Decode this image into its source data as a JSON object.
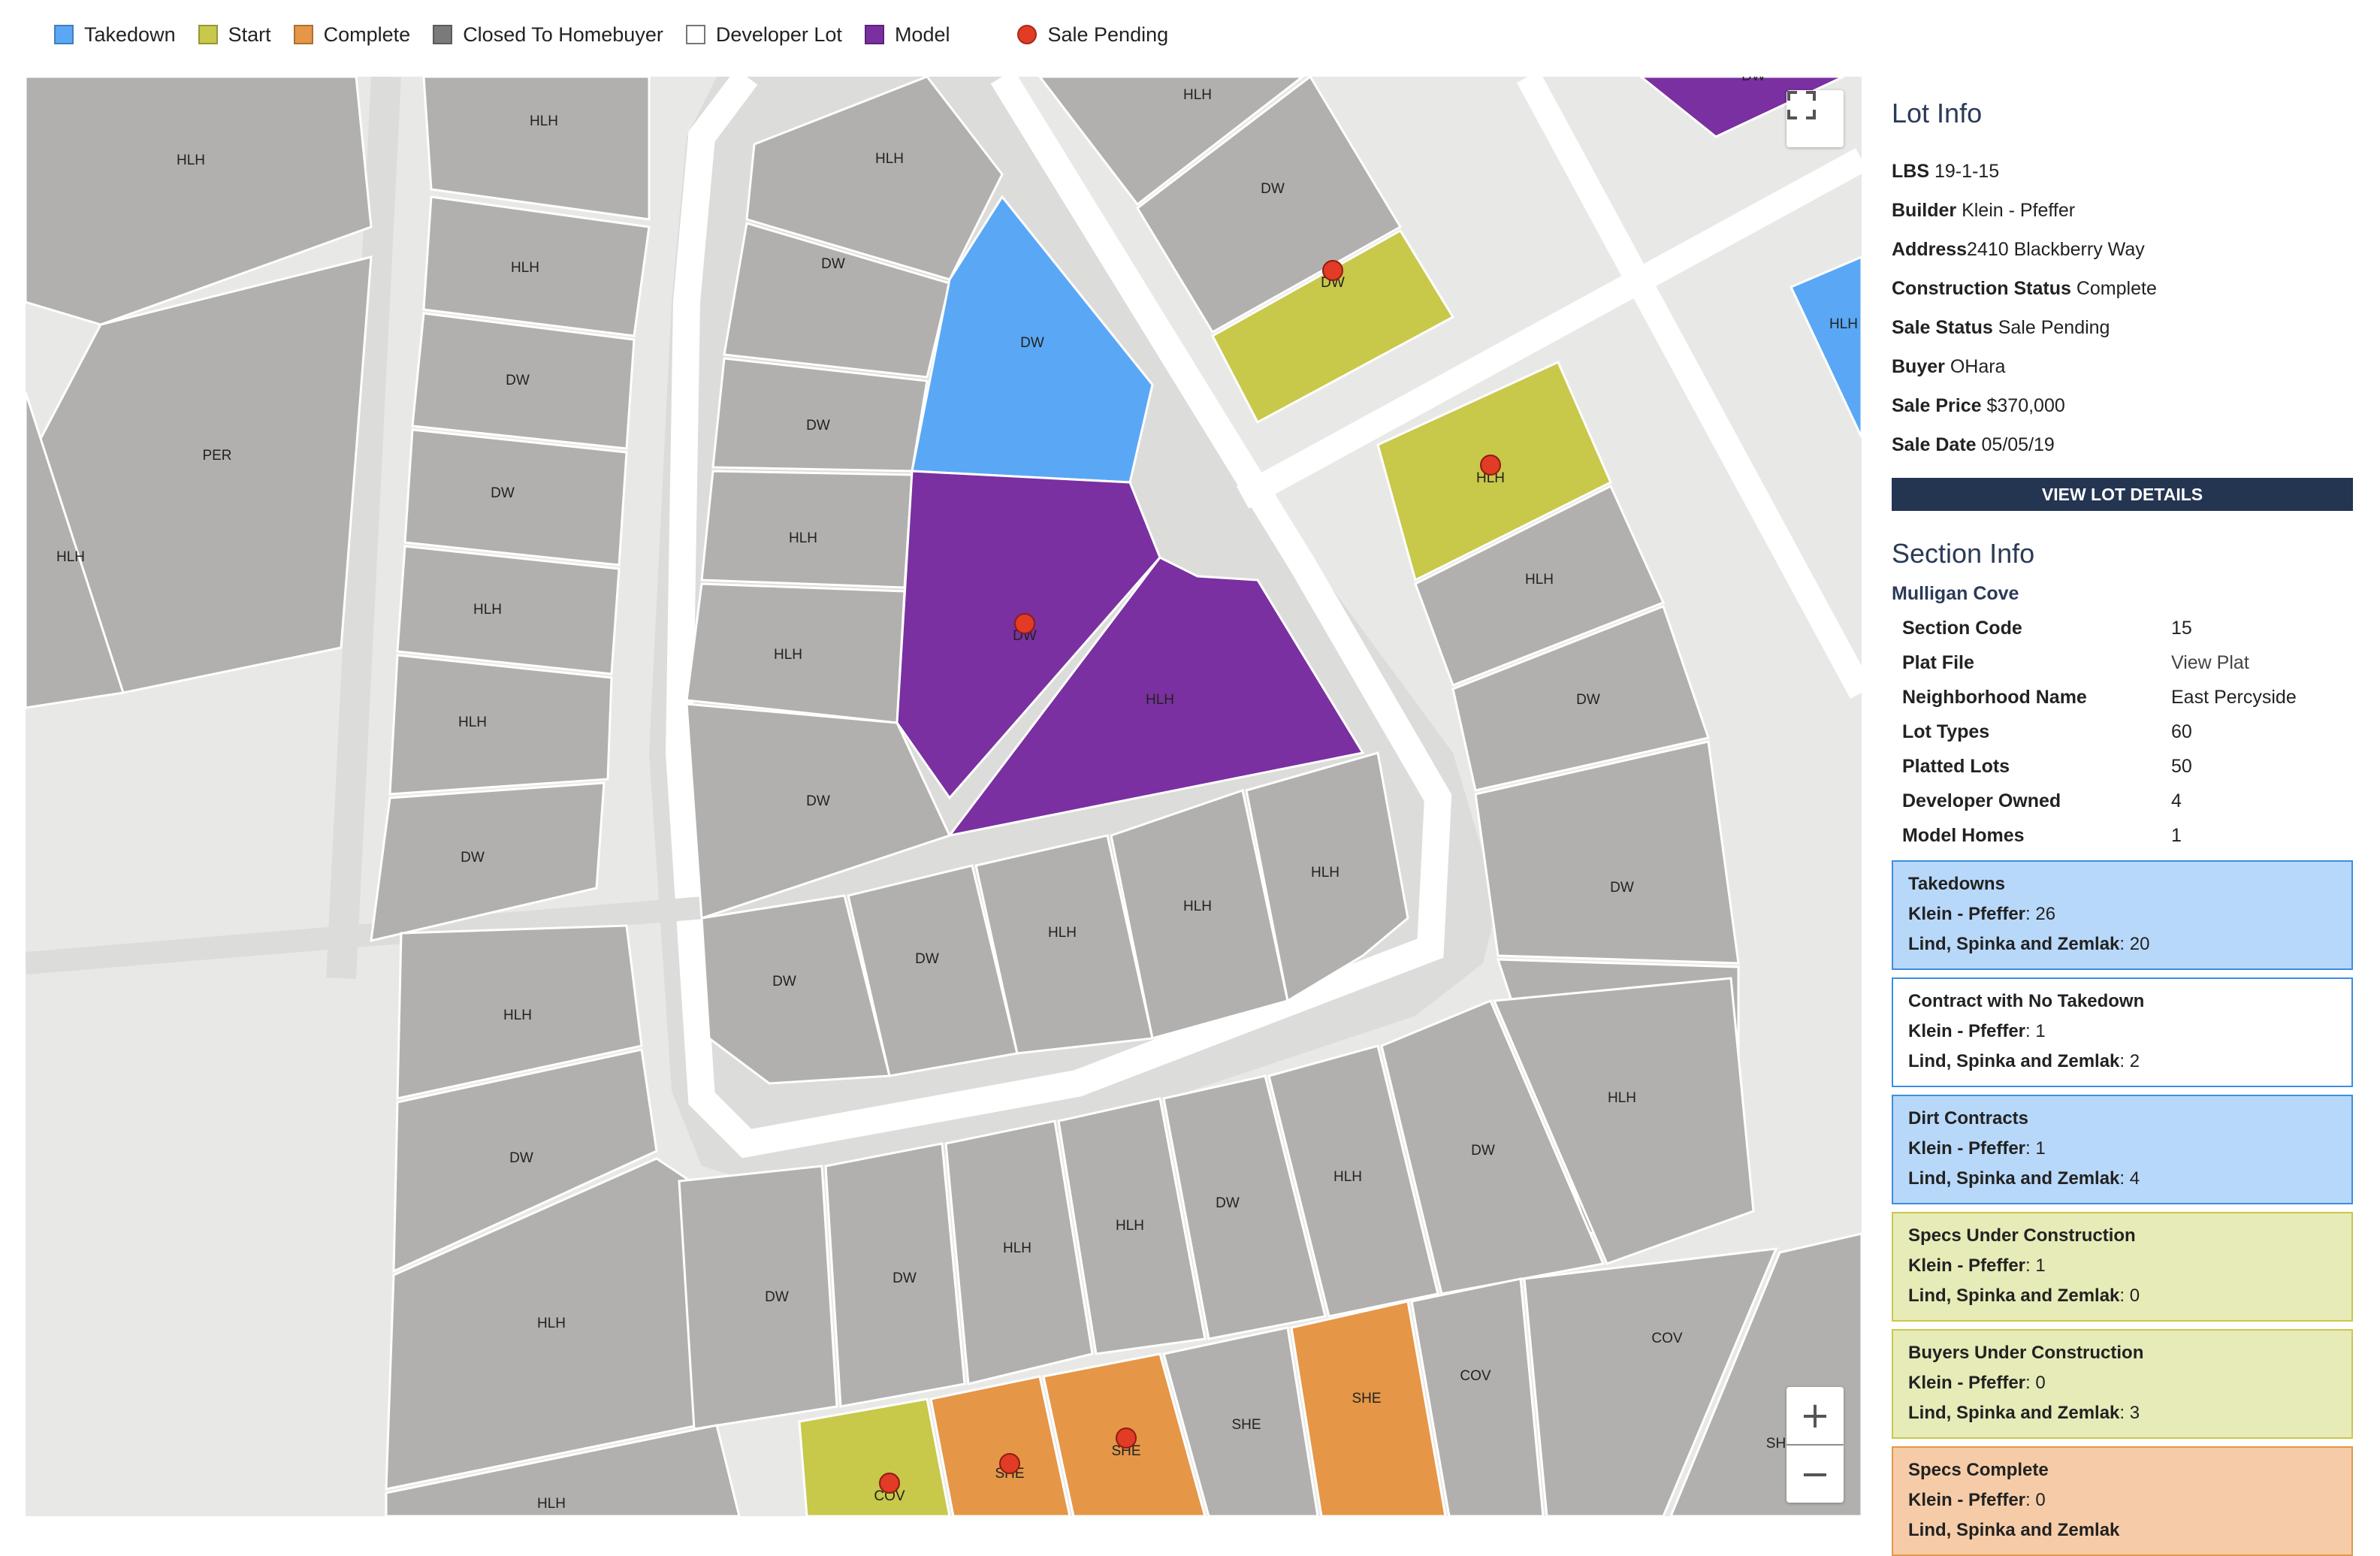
{
  "legend": [
    {
      "label": "Takedown",
      "color": "#5aa8f5",
      "kind": "square",
      "name": "takedown"
    },
    {
      "label": "Start",
      "color": "#c8c84a",
      "kind": "square",
      "name": "start"
    },
    {
      "label": "Complete",
      "color": "#e59647",
      "kind": "square",
      "name": "complete"
    },
    {
      "label": "Closed To Homebuyer",
      "color": "#7a7a7a",
      "kind": "square",
      "name": "closed"
    },
    {
      "label": "Developer Lot",
      "color": "#ffffff",
      "kind": "square",
      "name": "developer"
    },
    {
      "label": "Model",
      "color": "#7a30a0",
      "kind": "square",
      "name": "model"
    },
    {
      "label": "Sale Pending",
      "color": "#e23b26",
      "kind": "dot",
      "name": "sale-pending"
    }
  ],
  "map": {
    "controls": {
      "fullscreen_icon": "fullscreen-icon",
      "zoom_in": "+",
      "zoom_out": "−"
    },
    "lot_colors": {
      "default": "#b1b0ae",
      "takedown": "#5aa8f5",
      "start": "#c8c84a",
      "complete": "#e59647",
      "model": "#7a30a0"
    },
    "lot_labels": [
      "HLH",
      "DW",
      "PER",
      "SHE",
      "COV",
      "SH"
    ]
  },
  "lot_info": {
    "heading": "Lot Info",
    "rows": [
      {
        "label": "LBS",
        "value": " 19-1-15"
      },
      {
        "label": "Builder",
        "value": " Klein - Pfeffer"
      },
      {
        "label": "Address",
        "value": "2410 Blackberry Way"
      },
      {
        "label": "Construction Status",
        "value": " Complete"
      },
      {
        "label": "Sale Status",
        "value": " Sale Pending"
      },
      {
        "label": "Buyer",
        "value": " OHara"
      },
      {
        "label": "Sale Price",
        "value": " $370,000"
      },
      {
        "label": "Sale Date",
        "value": " 05/05/19"
      }
    ],
    "button": "VIEW LOT DETAILS"
  },
  "section_info": {
    "heading": "Section Info",
    "name": "Mulligan Cove",
    "stats": [
      {
        "label": "Section Code",
        "value": "15",
        "link": false
      },
      {
        "label": "Plat File",
        "value": "View Plat",
        "link": true
      },
      {
        "label": "Neighborhood Name",
        "value": "East Percyside",
        "link": false
      },
      {
        "label": "Lot Types",
        "value": "60",
        "link": false
      },
      {
        "label": "Platted Lots",
        "value": "50",
        "link": false
      },
      {
        "label": "Developer Owned",
        "value": "4",
        "link": false
      },
      {
        "label": "Model Homes",
        "value": "1",
        "link": false
      }
    ],
    "cards": [
      {
        "title": "Takedowns",
        "bg": "#b8d8fa",
        "border": "#3b8ee0",
        "lines": [
          {
            "builder": "Klein - Pfeffer",
            "value": ": 26"
          },
          {
            "builder": "Lind, Spinka and Zemlak",
            "value": ": 20"
          }
        ]
      },
      {
        "title": "Contract with No Takedown",
        "bg": "#ffffff",
        "border": "#3b8ee0",
        "lines": [
          {
            "builder": "Klein - Pfeffer",
            "value": ": 1"
          },
          {
            "builder": "Lind, Spinka and Zemlak",
            "value": ": 2"
          }
        ]
      },
      {
        "title": "Dirt Contracts",
        "bg": "#b8d8fa",
        "border": "#3b8ee0",
        "lines": [
          {
            "builder": "Klein - Pfeffer",
            "value": ": 1"
          },
          {
            "builder": "Lind, Spinka and Zemlak",
            "value": ": 4"
          }
        ]
      },
      {
        "title": "Specs Under Construction",
        "bg": "#e6ebb8",
        "border": "#c8c84a",
        "lines": [
          {
            "builder": "Klein - Pfeffer",
            "value": ": 1"
          },
          {
            "builder": "Lind, Spinka and Zemlak",
            "value": ": 0"
          }
        ]
      },
      {
        "title": "Buyers Under Construction",
        "bg": "#e6ebb8",
        "border": "#c8c84a",
        "lines": [
          {
            "builder": "Klein - Pfeffer",
            "value": ": 0"
          },
          {
            "builder": "Lind, Spinka and Zemlak",
            "value": ": 3"
          }
        ]
      },
      {
        "title": "Specs Complete",
        "bg": "#f6cca8",
        "border": "#e59647",
        "lines": [
          {
            "builder": "Klein - Pfeffer",
            "value": ": 0"
          },
          {
            "builder": "Lind, Spinka and Zemlak",
            "value": ""
          }
        ]
      }
    ]
  }
}
